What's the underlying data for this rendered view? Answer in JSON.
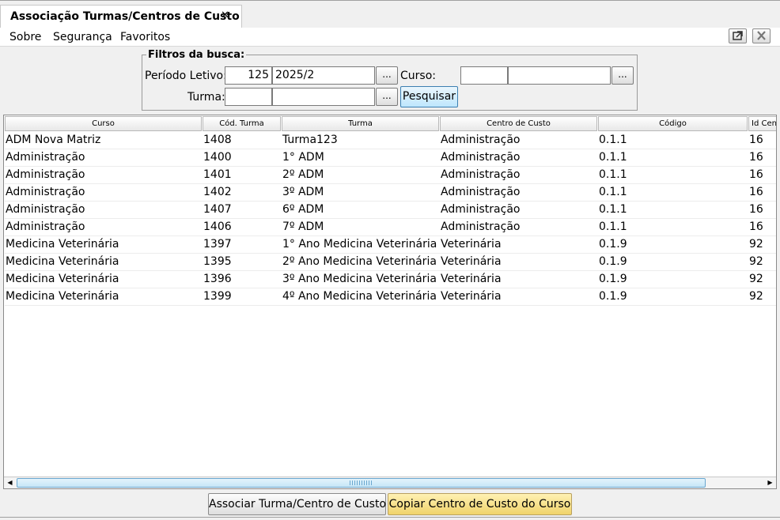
{
  "tab": {
    "title": "Associação Turmas/Centros de Custo",
    "close": "✕"
  },
  "menu": {
    "sobre": "Sobre",
    "seguranca": "Segurança",
    "favoritos": "Favoritos"
  },
  "window_buttons": {
    "popout": "⧉",
    "close": "✕"
  },
  "filters": {
    "legend": "Filtros da busca:",
    "periodo_label": "Período Letivo:",
    "periodo_code": "125",
    "periodo_name": "2025/2",
    "curso_label": "Curso:",
    "curso_code": "",
    "curso_name": "",
    "turma_label": "Turma:",
    "turma_code": "",
    "turma_name": "",
    "dots": "...",
    "search": "Pesquisar"
  },
  "table": {
    "headers": [
      "Curso",
      "Cód. Turma",
      "Turma",
      "Centro de Custo",
      "Código",
      "Id Cen"
    ],
    "rows": [
      [
        "ADM Nova Matriz",
        "1408",
        "Turma123",
        "Administração",
        "0.1.1",
        "16"
      ],
      [
        "Administração",
        "1400",
        "1° ADM",
        "Administração",
        "0.1.1",
        "16"
      ],
      [
        "Administração",
        "1401",
        "2º ADM",
        "Administração",
        "0.1.1",
        "16"
      ],
      [
        "Administração",
        "1402",
        "3º ADM",
        "Administração",
        "0.1.1",
        "16"
      ],
      [
        "Administração",
        "1407",
        "6º ADM",
        "Administração",
        "0.1.1",
        "16"
      ],
      [
        "Administração",
        "1406",
        "7º ADM",
        "Administração",
        "0.1.1",
        "16"
      ],
      [
        "Medicina Veterinária",
        "1397",
        "1°  Ano Medicina Veterinária",
        "Veterinária",
        "0.1.9",
        "92"
      ],
      [
        "Medicina Veterinária",
        "1395",
        "2º Ano Medicina Veterinária",
        "Veterinária",
        "0.1.9",
        "92"
      ],
      [
        "Medicina Veterinária",
        "1396",
        "3º Ano Medicina Veterinária",
        "Veterinária",
        "0.1.9",
        "92"
      ],
      [
        "Medicina Veterinária",
        "1399",
        "4º Ano Medicina Veterinária",
        "Veterinária",
        "0.1.9",
        "92"
      ]
    ]
  },
  "buttons": {
    "associar": "Associar Turma/Centro de Custo",
    "copiar": "Copiar Centro de Custo do Curso"
  },
  "colors": {
    "accent": "#3c7fb1",
    "copy_button": "#f0d36a"
  }
}
